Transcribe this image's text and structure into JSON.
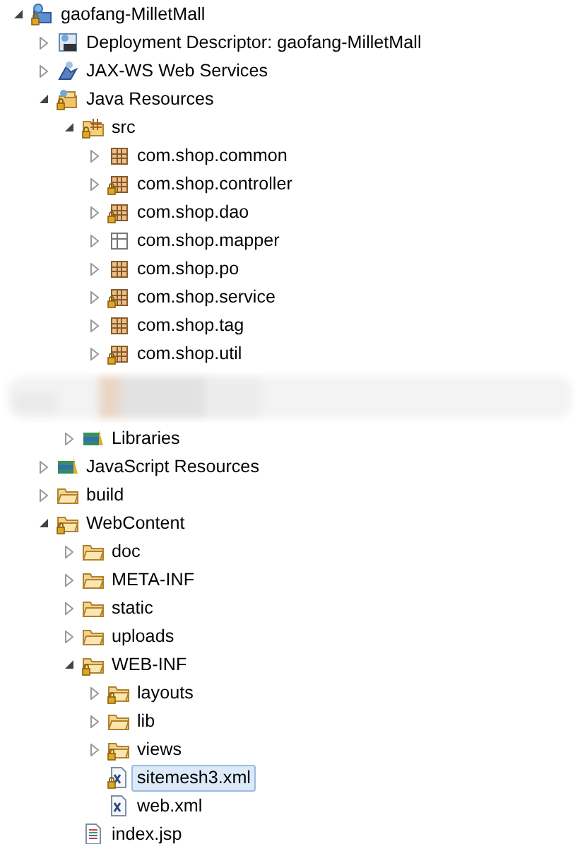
{
  "tree": [
    {
      "label": "gaofang-MilletMall",
      "kind": "project",
      "locked": true,
      "expanded": true,
      "selected": false,
      "children": [
        {
          "label": "Deployment Descriptor: gaofang-MilletMall",
          "kind": "descriptor",
          "locked": false,
          "expanded": false,
          "selected": false
        },
        {
          "label": "JAX-WS Web Services",
          "kind": "webservices",
          "locked": false,
          "expanded": false,
          "selected": false
        },
        {
          "label": "Java Resources",
          "kind": "java-resources",
          "locked": true,
          "expanded": true,
          "selected": false,
          "children": [
            {
              "label": "src",
              "kind": "source-folder",
              "locked": true,
              "expanded": true,
              "selected": false,
              "children": [
                {
                  "label": "com.shop.common",
                  "kind": "package",
                  "locked": false,
                  "expanded": false,
                  "selected": false
                },
                {
                  "label": "com.shop.controller",
                  "kind": "package",
                  "locked": true,
                  "expanded": false,
                  "selected": false
                },
                {
                  "label": "com.shop.dao",
                  "kind": "package",
                  "locked": true,
                  "expanded": false,
                  "selected": false
                },
                {
                  "label": "com.shop.mapper",
                  "kind": "package-empty",
                  "locked": false,
                  "expanded": false,
                  "selected": false
                },
                {
                  "label": "com.shop.po",
                  "kind": "package",
                  "locked": false,
                  "expanded": false,
                  "selected": false
                },
                {
                  "label": "com.shop.service",
                  "kind": "package",
                  "locked": true,
                  "expanded": false,
                  "selected": false
                },
                {
                  "label": "com.shop.tag",
                  "kind": "package",
                  "locked": false,
                  "expanded": false,
                  "selected": false
                },
                {
                  "label": "com.shop.util",
                  "kind": "package",
                  "locked": true,
                  "expanded": false,
                  "selected": false
                }
              ]
            },
            {
              "kind": "blurred"
            },
            {
              "label": "Libraries",
              "kind": "library",
              "locked": false,
              "expanded": false,
              "selected": false
            }
          ]
        },
        {
          "label": "JavaScript Resources",
          "kind": "library",
          "locked": false,
          "expanded": false,
          "selected": false
        },
        {
          "label": "build",
          "kind": "folder",
          "locked": false,
          "expanded": false,
          "selected": false
        },
        {
          "label": "WebContent",
          "kind": "folder",
          "locked": true,
          "expanded": true,
          "selected": false,
          "children": [
            {
              "label": "doc",
              "kind": "folder",
              "locked": false,
              "expanded": false,
              "selected": false
            },
            {
              "label": "META-INF",
              "kind": "folder",
              "locked": false,
              "expanded": false,
              "selected": false
            },
            {
              "label": "static",
              "kind": "folder",
              "locked": false,
              "expanded": false,
              "selected": false
            },
            {
              "label": "uploads",
              "kind": "folder",
              "locked": false,
              "expanded": false,
              "selected": false
            },
            {
              "label": "WEB-INF",
              "kind": "folder",
              "locked": true,
              "expanded": true,
              "selected": false,
              "children": [
                {
                  "label": "layouts",
                  "kind": "folder",
                  "locked": true,
                  "expanded": false,
                  "selected": false
                },
                {
                  "label": "lib",
                  "kind": "folder",
                  "locked": false,
                  "expanded": false,
                  "selected": false
                },
                {
                  "label": "views",
                  "kind": "folder",
                  "locked": true,
                  "expanded": false,
                  "selected": false
                },
                {
                  "label": "sitemesh3.xml",
                  "kind": "xml",
                  "locked": true,
                  "selected": true
                },
                {
                  "label": "web.xml",
                  "kind": "xml",
                  "locked": false,
                  "selected": false
                }
              ]
            },
            {
              "label": "index.jsp",
              "kind": "jsp",
              "locked": false,
              "selected": false
            }
          ]
        }
      ]
    }
  ]
}
